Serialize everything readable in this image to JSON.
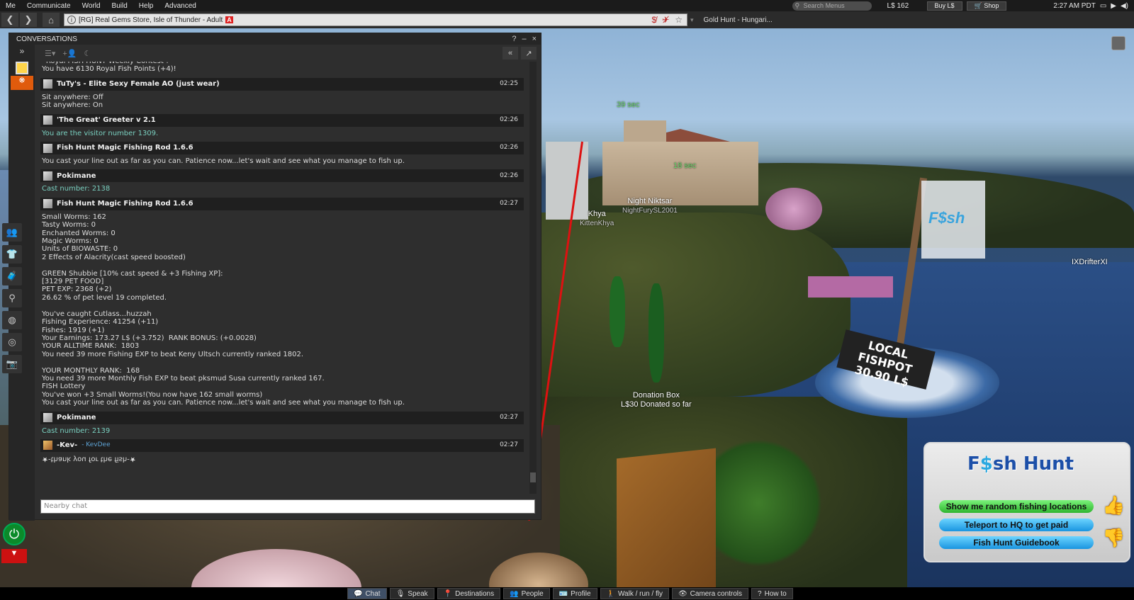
{
  "menubar": {
    "items": [
      "Me",
      "Communicate",
      "World",
      "Build",
      "Help",
      "Advanced"
    ],
    "search_placeholder": "Search Menus",
    "balance": "L$ 162",
    "buy_label": "Buy L$",
    "shop_label": "Shop",
    "time": "2:27 AM PDT"
  },
  "navbar": {
    "location": "[RG] Real Gems Store, Isle of Thunder - Adult",
    "adult_badge": "A",
    "tab": "Gold Hunt - Hungari..."
  },
  "conversations": {
    "title": "CONVERSATIONS",
    "help": "?",
    "minimize": "–",
    "close": "×",
    "top_lines": [
      "' Royal FISH HUNT Weekly Contest !",
      "You have 6130 Royal Fish Points (+4)!"
    ],
    "messages": [
      {
        "sender": "TuTy's - Elite Sexy Female AO (just wear)",
        "time": "02:25",
        "type": "object",
        "lines": [
          "Sit anywhere: Off",
          "Sit anywhere: On"
        ],
        "color": "white"
      },
      {
        "sender": "'The Great' Greeter v 2.1",
        "time": "02:26",
        "type": "object",
        "lines": [
          "You are the visitor number 1309."
        ],
        "color": "teal"
      },
      {
        "sender": "Fish Hunt Magic Fishing Rod 1.6.6",
        "time": "02:26",
        "type": "object",
        "lines": [
          "You cast your line out as far as you can. Patience now...let's wait and see what you manage to fish up."
        ],
        "color": "white"
      },
      {
        "sender": "Pokimane",
        "time": "02:26",
        "type": "object",
        "lines": [
          "Cast number: 2138"
        ],
        "color": "teal"
      },
      {
        "sender": "Fish Hunt Magic Fishing Rod 1.6.6",
        "time": "02:27",
        "type": "object",
        "lines": [
          "Small Worms: 162",
          "Tasty Worms: 0",
          "Enchanted Worms: 0",
          "Magic Worms: 0",
          "Units of BIOWASTE: 0",
          "2 Effects of Alacrity(cast speed boosted)",
          "",
          "GREEN Shubbie [10% cast speed & +3 Fishing XP]:",
          "[3129 PET FOOD]",
          "PET EXP: 2368 (+2)",
          "26.62 % of pet level 19 completed.",
          "",
          "You've caught Cutlass...huzzah",
          "Fishing Experience: 41254 (+11)",
          "Fishes: 1919 (+1)",
          "Your Earnings: 173.27 L$ (+3.752)  RANK BONUS: (+0.0028)",
          "YOUR ALLTIME RANK:  1803",
          "You need 39 more Fishing EXP to beat Keny Ultsch currently ranked 1802.",
          "",
          "YOUR MONTHLY RANK:  168",
          "You need 39 more Monthly Fish EXP to beat pksmud Susa currently ranked 167.",
          "FISH Lottery",
          "You've won +3 Small Worms!(You now have 162 small worms)",
          "You cast your line out as far as you can. Patience now...let's wait and see what you manage to fish up."
        ],
        "color": "white"
      },
      {
        "sender": "Pokimane",
        "time": "02:27",
        "type": "object",
        "lines": [
          "Cast number: 2139"
        ],
        "color": "teal"
      },
      {
        "sender": "-Kev-",
        "username": "- KevDee",
        "time": "02:27",
        "type": "avatar",
        "lines": [
          "★-thank you for the fish-★"
        ],
        "color": "white",
        "flipped": true
      }
    ],
    "input_placeholder": "Nearby chat"
  },
  "scene_tags": {
    "khya_name": "Khya",
    "khya_user": "KittenKhya",
    "night_name": "Night Niktsar",
    "night_user": "NightFurySL2001",
    "ixdrifter": "IXDrifterXI",
    "donation_title": "Donation Box",
    "donation_sub": "L$30 Donated so far",
    "sign_line1": "LOCAL FISHPOT",
    "sign_line2": "30.90 L$",
    "flag_text": "F$sh",
    "timer1": "39 sec",
    "timer2": "18 sec"
  },
  "hud": {
    "logo_left": "F",
    "logo_dollar": "$",
    "logo_right": "sh Hunt",
    "btn_random": "Show me random fishing locations",
    "btn_teleport": "Teleport to HQ to get paid",
    "btn_guide": "Fish Hunt Guidebook"
  },
  "bottombar": {
    "items": [
      "Chat",
      "Speak",
      "Destinations",
      "People",
      "Profile",
      "Walk / run / fly",
      "Camera controls",
      "How to"
    ]
  }
}
